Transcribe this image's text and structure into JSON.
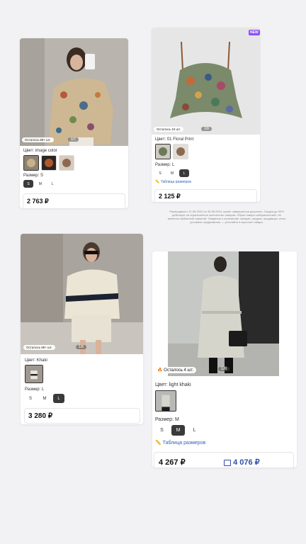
{
  "cards": [
    {
      "stock": "Осталось 99+ шт.",
      "pager": "1/7",
      "color_label": "Цвет: image color",
      "size_label": "Размер: S",
      "sizes": [
        "S",
        "M",
        "L"
      ],
      "selected_size": "S",
      "price": "2 763 ₽"
    },
    {
      "new_badge": "NEW",
      "stock": "Осталось 10 шт.",
      "pager": "1/8",
      "color_label": "Цвет: 01 Floral Print",
      "size_label": "Размер: L",
      "sizes": [
        "S",
        "M",
        "L"
      ],
      "selected_size": "L",
      "size_table": "Таблица размеров",
      "price": "2 125 ₽"
    },
    {
      "stock": "Осталось 99+ шт.",
      "pager": "1/8",
      "color_label": "Цвет: Khaki",
      "size_label": "Размер: L",
      "sizes": [
        "S",
        "M",
        "L"
      ],
      "selected_size": "L",
      "price": "3 280 ₽"
    },
    {
      "stock": "Осталось 4 шт.",
      "pager": "1/8",
      "color_label": "Цвет: light khaki",
      "size_label": "Размер: M",
      "sizes": [
        "S",
        "M",
        "L"
      ],
      "selected_size": "M",
      "size_table": "Таблица размеров",
      "price": "4 267 ₽",
      "price_alt": "4 076 ₽"
    }
  ],
  "promo_text": "Распродажа с 21.06.2024 по 30.06.2024, может завершиться досрочно. Скидка до 90% действует на ограниченное количество товаров. Образ товара собирательный. Не является публичной офертой. Сведения о количестве товаров, скидках, продавцах, иных условиях продвижения — уточняйте в карточке товара.",
  "colors": {
    "accent_blue": "#2f5fb8",
    "selected_chip": "#3a3a3a",
    "new_badge": "#8a52f2"
  }
}
